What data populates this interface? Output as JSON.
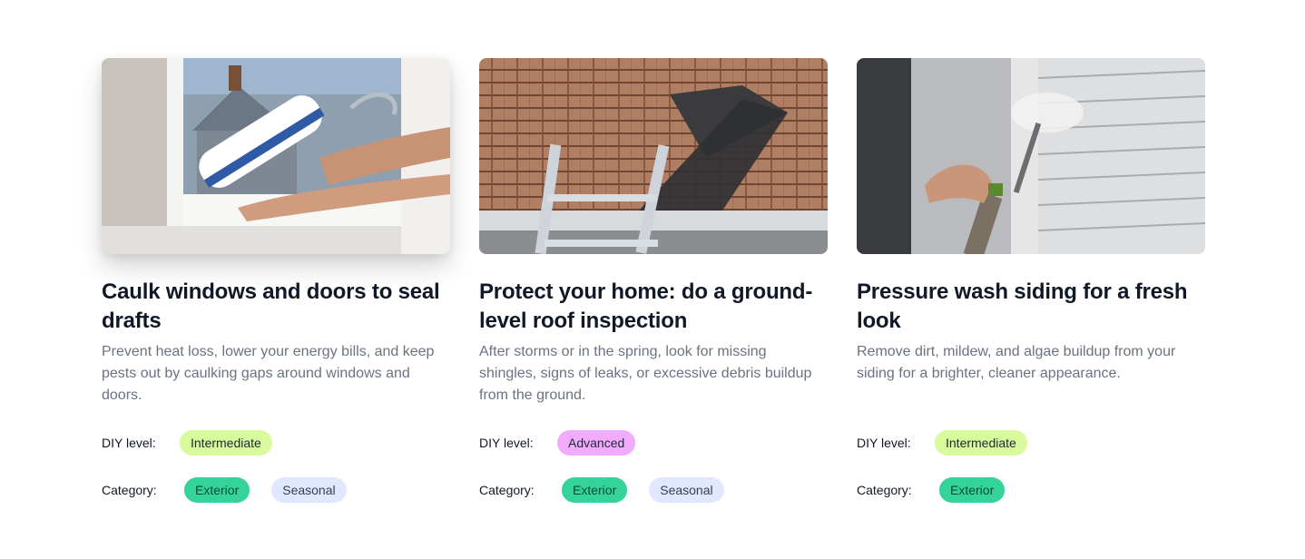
{
  "cards": [
    {
      "title": "Caulk windows and doors to seal drafts",
      "description": "Prevent heat loss, lower your energy bills, and keep pests out by caulking gaps around windows and doors.",
      "diy_label": "DIY level:",
      "diy_level": "Intermediate",
      "category_label": "Category:",
      "categories": [
        "Exterior",
        "Seasonal"
      ]
    },
    {
      "title": "Protect your home: do a ground-level roof inspection",
      "description": "After storms or in the spring, look for missing shingles, signs of leaks, or excessive debris buildup from the ground.",
      "diy_label": "DIY level:",
      "diy_level": "Advanced",
      "category_label": "Category:",
      "categories": [
        "Exterior",
        "Seasonal"
      ]
    },
    {
      "title": "Pressure wash siding for a fresh look",
      "description": "Remove dirt, mildew, and algae buildup from your siding for a brighter, cleaner appearance.",
      "diy_label": "DIY level:",
      "diy_level": "Intermediate",
      "category_label": "Category:",
      "categories": [
        "Exterior"
      ]
    }
  ],
  "colors": {
    "intermediate": "#d9f99d",
    "advanced": "#f0abfc",
    "exterior": "#34d399",
    "seasonal": "#e0e7ff"
  }
}
